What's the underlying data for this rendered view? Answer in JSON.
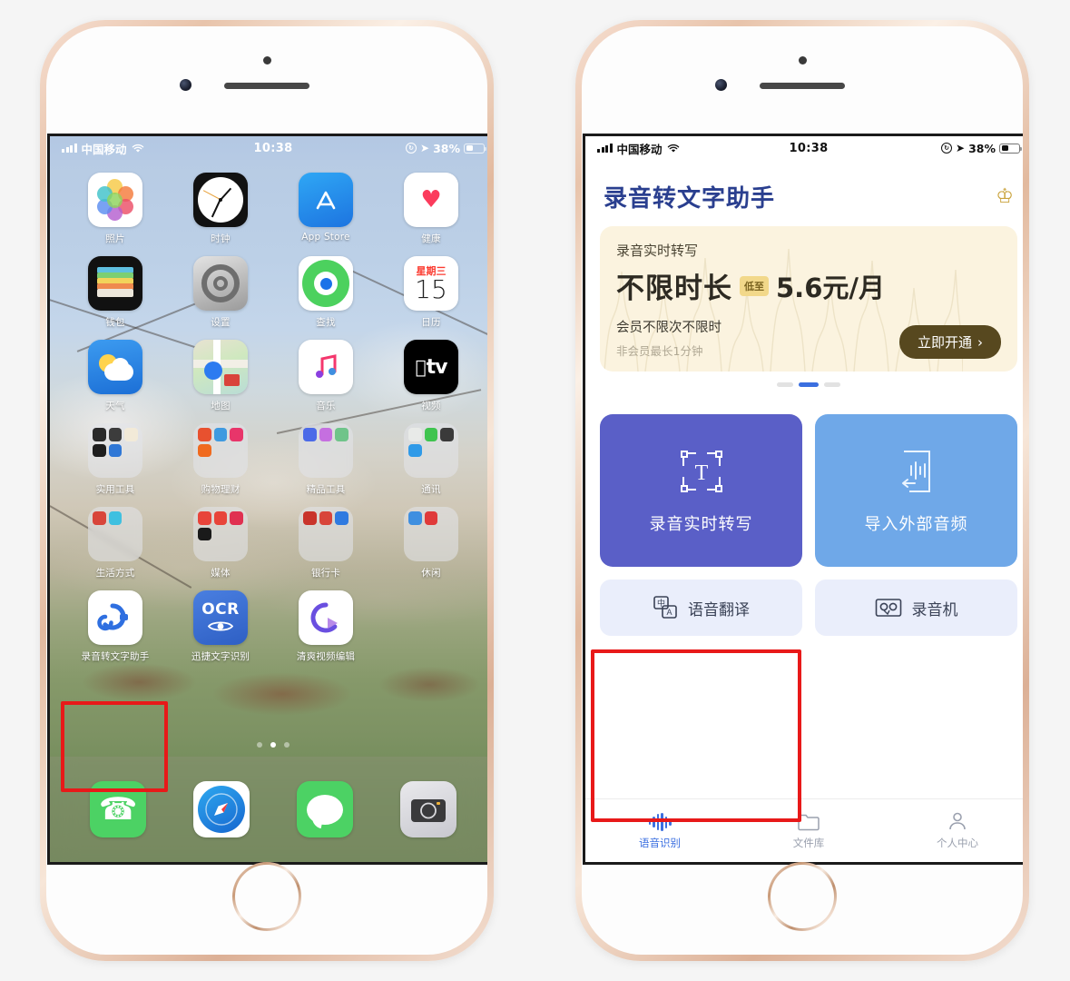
{
  "status_bar": {
    "carrier": "中国移动",
    "time": "10:38",
    "battery_percent": "38%",
    "signal_icon": "signal-bars-icon",
    "wifi_icon": "wifi-icon",
    "lock_icon": "rotation-lock-icon",
    "location_icon": "location-arrow-icon",
    "battery_icon": "battery-icon"
  },
  "home_screen": {
    "apps": [
      {
        "label": "照片",
        "icon": "photos-icon"
      },
      {
        "label": "时钟",
        "icon": "clock-icon"
      },
      {
        "label": "App Store",
        "icon": "app-store-icon"
      },
      {
        "label": "健康",
        "icon": "health-icon"
      },
      {
        "label": "钱包",
        "icon": "wallet-icon"
      },
      {
        "label": "设置",
        "icon": "settings-icon"
      },
      {
        "label": "查找",
        "icon": "find-my-icon"
      },
      {
        "label": "日历",
        "icon": "calendar-icon"
      },
      {
        "label": "天气",
        "icon": "weather-icon"
      },
      {
        "label": "地图",
        "icon": "maps-icon"
      },
      {
        "label": "音乐",
        "icon": "music-icon"
      },
      {
        "label": "视频",
        "icon": "apple-tv-icon"
      },
      {
        "label": "实用工具",
        "icon": "folder-icon"
      },
      {
        "label": "购物理财",
        "icon": "folder-icon"
      },
      {
        "label": "精品工具",
        "icon": "folder-icon"
      },
      {
        "label": "通讯",
        "icon": "folder-icon"
      },
      {
        "label": "生活方式",
        "icon": "folder-icon"
      },
      {
        "label": "媒体",
        "icon": "folder-icon"
      },
      {
        "label": "银行卡",
        "icon": "folder-icon"
      },
      {
        "label": "休闲",
        "icon": "folder-icon"
      },
      {
        "label": "录音转文字助手",
        "icon": "recorder-to-text-icon"
      },
      {
        "label": "迅捷文字识别",
        "icon": "ocr-icon"
      },
      {
        "label": "清爽视频编辑",
        "icon": "video-editor-icon"
      }
    ],
    "calendar_weekday": "星期三",
    "calendar_day": "15",
    "appstore_label": "App Store",
    "apple_tv_label": "tv",
    "ocr_label": "OCR",
    "page_dots": {
      "count": 3,
      "active_index": 1
    },
    "dock": [
      {
        "label": "电话",
        "icon": "phone-icon"
      },
      {
        "label": "Safari",
        "icon": "safari-icon"
      },
      {
        "label": "信息",
        "icon": "messages-icon"
      },
      {
        "label": "相机",
        "icon": "camera-icon"
      }
    ],
    "highlight": {
      "target_label": "录音转文字助手",
      "color": "#e81919"
    }
  },
  "app_screen": {
    "title": "录音转文字助手",
    "crown_icon": "crown-icon",
    "promo": {
      "subtitle": "录音实时转写",
      "headline": "不限时长",
      "badge": "低至",
      "price": "5.6元/月",
      "line1": "会员不限次不限时",
      "line2": "非会员最长1分钟",
      "cta": "立即开通",
      "cta_chevron": "›",
      "bg_color": "#fbf3df",
      "cta_color": "#57481f"
    },
    "carousel_dots": {
      "count": 3,
      "active_index": 1
    },
    "tiles": [
      {
        "label": "录音实时转写",
        "icon": "text-select-icon",
        "color": "#5a5fc7",
        "highlighted": true
      },
      {
        "label": "导入外部音频",
        "icon": "import-audio-icon",
        "color": "#6fa8e8",
        "highlighted": false
      }
    ],
    "quick_actions": [
      {
        "label": "语音翻译",
        "icon": "translate-icon"
      },
      {
        "label": "录音机",
        "icon": "tape-recorder-icon"
      }
    ],
    "tabs": [
      {
        "label": "语音识别",
        "icon": "waveform-icon",
        "active": true
      },
      {
        "label": "文件库",
        "icon": "folder-icon",
        "active": false
      },
      {
        "label": "个人中心",
        "icon": "person-icon",
        "active": false
      }
    ],
    "accent_color": "#3b6fe0"
  }
}
